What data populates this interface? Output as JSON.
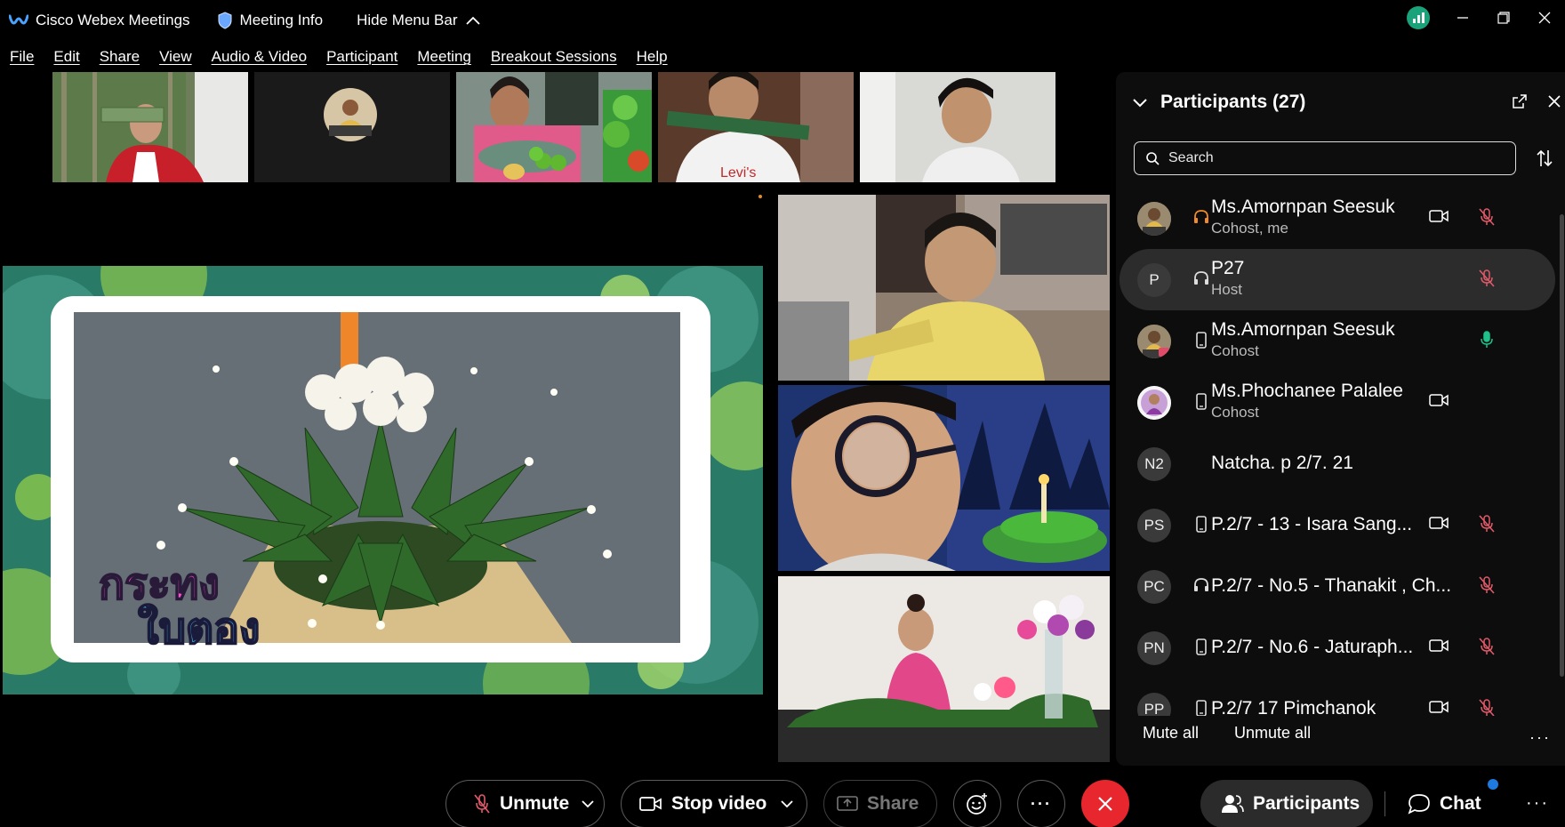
{
  "window": {
    "app_title": "Cisco Webex Meetings",
    "meeting_info": "Meeting Info",
    "hide_menu_bar": "Hide Menu Bar"
  },
  "menu": [
    "File",
    "Edit",
    "Share",
    "View",
    "Audio & Video",
    "Participant",
    "Meeting",
    "Breakout Sessions",
    "Help"
  ],
  "shared_content": {
    "text_line1": "กระทง",
    "text_line2": "ใบตอง"
  },
  "participants_panel": {
    "title": "Participants (27)",
    "search_placeholder": "Search",
    "mute_all": "Mute all",
    "unmute_all": "Unmute all",
    "participants": [
      {
        "name": "Ms.Amornpan Seesuk",
        "role": "Cohost, me",
        "initials": "",
        "device": "headset-icon",
        "camera": true,
        "mic": "muted"
      },
      {
        "name": "P27",
        "role": "Host",
        "initials": "P",
        "device": "headset-icon",
        "camera": false,
        "mic": "muted"
      },
      {
        "name": "Ms.Amornpan Seesuk",
        "role": "Cohost",
        "initials": "",
        "device": "phone-icon",
        "camera": false,
        "mic": "active"
      },
      {
        "name": "Ms.Phochanee Palalee",
        "role": "Cohost",
        "initials": "",
        "device": "phone-icon",
        "camera": true,
        "mic": "none"
      },
      {
        "name": "Natcha. p 2/7. 21",
        "role": "",
        "initials": "N2",
        "device": "none",
        "camera": false,
        "mic": "none"
      },
      {
        "name": "P.2/7 - 13 - Isara Sang...",
        "role": "",
        "initials": "PS",
        "device": "phone-icon",
        "camera": true,
        "mic": "muted"
      },
      {
        "name": "P.2/7 - No.5 - Thanakit , Ch...",
        "role": "",
        "initials": "PC",
        "device": "headset-icon",
        "camera": false,
        "mic": "muted"
      },
      {
        "name": "P.2/7 - No.6 - Jaturaph...",
        "role": "",
        "initials": "PN",
        "device": "phone-icon",
        "camera": true,
        "mic": "muted"
      },
      {
        "name": "P.2/7 17 Pimchanok",
        "role": "",
        "initials": "PP",
        "device": "phone-icon",
        "camera": true,
        "mic": "muted"
      }
    ]
  },
  "toolbar": {
    "unmute": "Unmute",
    "stop_video": "Stop video",
    "share": "Share",
    "participants": "Participants",
    "chat": "Chat",
    "more": "···"
  },
  "colors": {
    "end_call": "#e8262d",
    "muted_mic": "#e05a6a",
    "active_mic": "#1fc08a",
    "webex_blue": "#3b82f6",
    "chat_badge": "#1e7ae0"
  }
}
